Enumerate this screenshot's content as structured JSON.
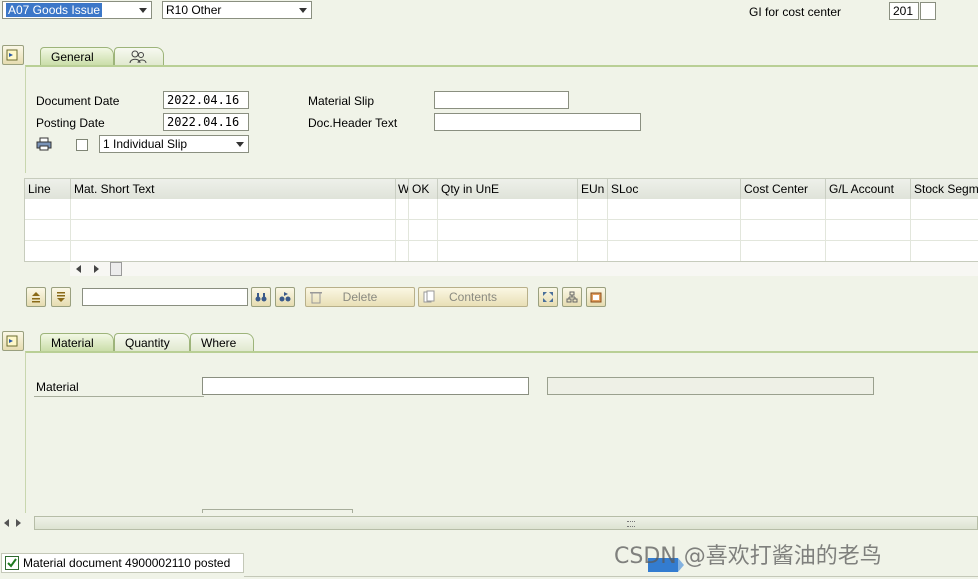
{
  "header": {
    "action_select": "A07 Goods Issue",
    "movement_select": "R10 Other",
    "gi_label": "GI for cost center",
    "movement_type_value": "201"
  },
  "general_tabs": [
    {
      "label": "General"
    },
    {
      "label": ""
    }
  ],
  "general": {
    "document_date_label": "Document Date",
    "document_date_value": "2022.04.16",
    "posting_date_label": "Posting Date",
    "posting_date_value": "2022.04.16",
    "material_slip_label": "Material Slip",
    "material_slip_value": "",
    "doc_header_text_label": "Doc.Header Text",
    "doc_header_text_value": "",
    "slip_select": "1 Individual Slip"
  },
  "items_table": {
    "columns": [
      "Line",
      "Mat. Short Text",
      "W",
      "OK",
      "Qty in UnE",
      "EUn",
      "SLoc",
      "Cost Center",
      "G/L Account",
      "Stock Segm"
    ]
  },
  "toolbar": {
    "search_value": "",
    "delete_label": "Delete",
    "contents_label": "Contents"
  },
  "detail_tabs": [
    {
      "label": "Material"
    },
    {
      "label": "Quantity"
    },
    {
      "label": "Where"
    }
  ],
  "detail": {
    "material_label": "Material",
    "material_value": "",
    "material_description": ""
  },
  "status": {
    "message": "Material document 4900002110 posted"
  },
  "watermark": {
    "text": "CSDN @喜欢打酱油的老鸟"
  }
}
